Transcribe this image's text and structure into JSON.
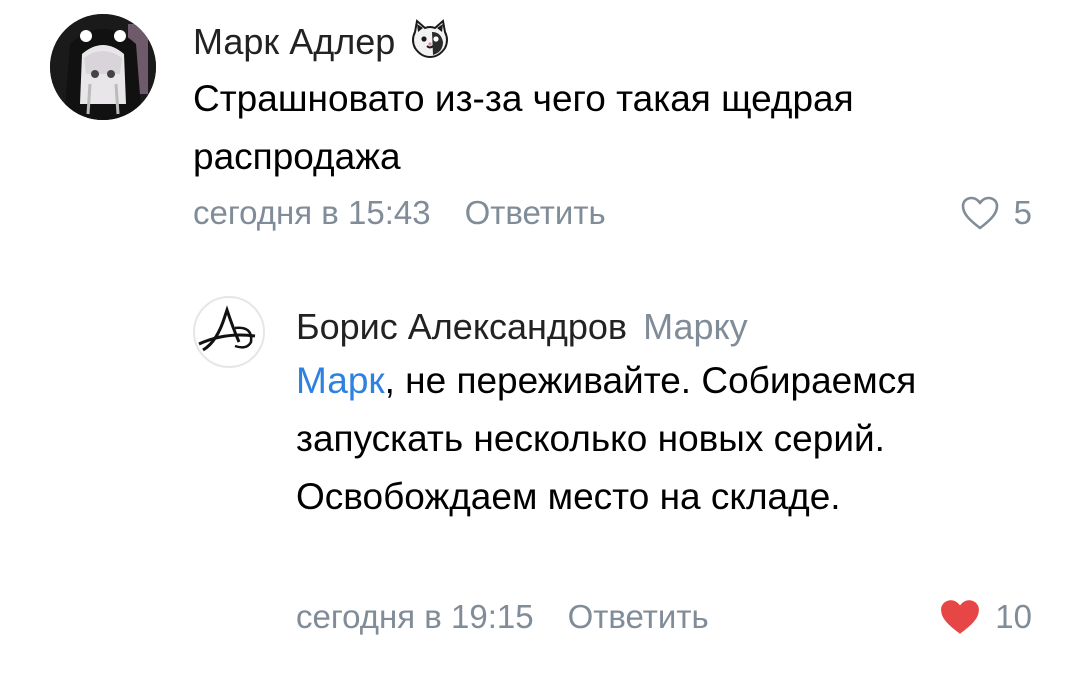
{
  "comments": [
    {
      "author": "Марк Адлер",
      "author_badge_icon": "cat-face-icon",
      "text": "Страшновато из-за чего такая щедрая распродажа",
      "time": "сегодня в 15:43",
      "reply_label": "Ответить",
      "likes": "5",
      "liked": false
    },
    {
      "author": "Борис Александров",
      "reply_to": "Марку",
      "mention": "Марк",
      "text": ", не переживайте. Собираемся запускать несколько новых серий. Освобождаем место на складе.",
      "time": "сегодня в 19:15",
      "reply_label": "Ответить",
      "likes": "10",
      "liked": true
    }
  ],
  "colors": {
    "meta": "#818c99",
    "mention": "#2d81e0",
    "like_active": "#e64646"
  }
}
